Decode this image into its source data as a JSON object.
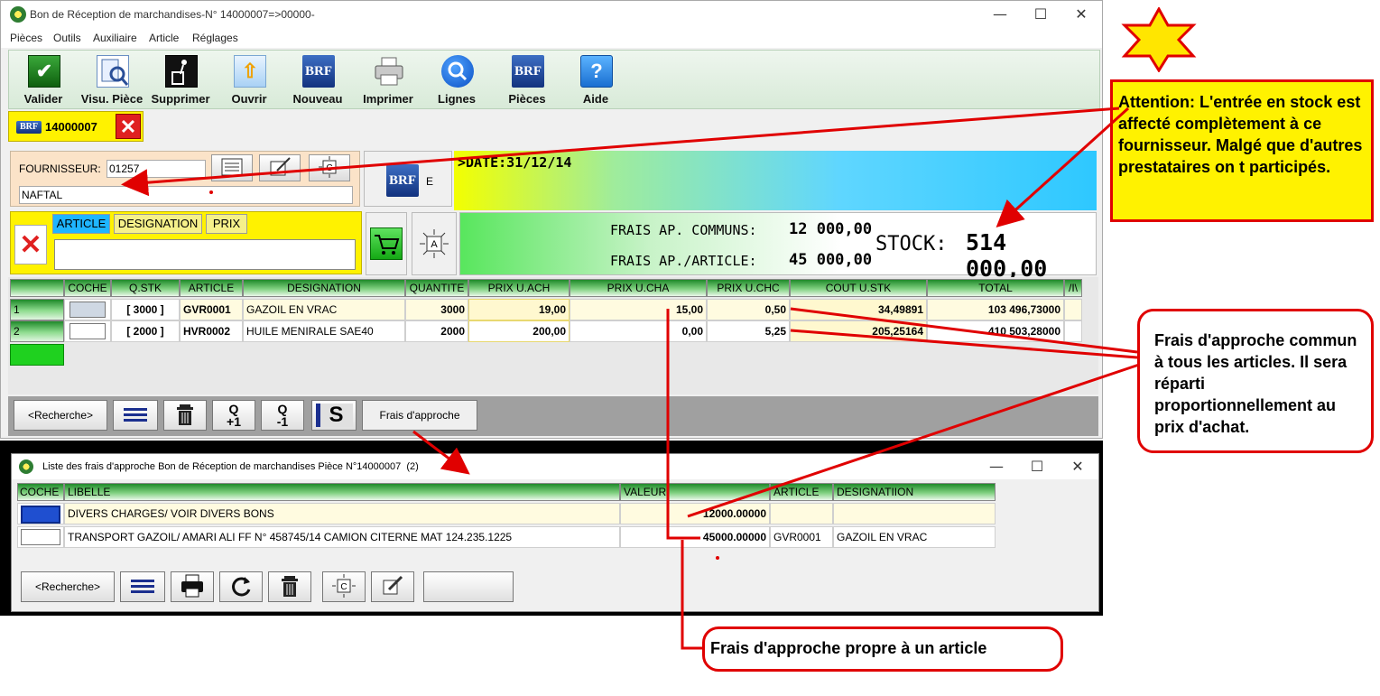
{
  "main_window": {
    "title": "Bon de Réception de marchandises-N° 14000007=>00000-",
    "controls": {
      "minimize": "—",
      "maximize": "☐",
      "close": "✕"
    },
    "menu": [
      "Pièces",
      "Outils",
      "Auxiliaire",
      "Article",
      "Réglages"
    ],
    "toolbar": [
      {
        "label": "Valider",
        "icon": "valider-icon"
      },
      {
        "label": "Visu. Pièce",
        "icon": "preview-icon"
      },
      {
        "label": "Supprimer",
        "icon": "trash-icon"
      },
      {
        "label": "Ouvrir",
        "icon": "open-icon"
      },
      {
        "label": "Nouveau",
        "icon": "brf-logo-icon"
      },
      {
        "label": "Imprimer",
        "icon": "printer-icon"
      },
      {
        "label": "Lignes",
        "icon": "search-icon"
      },
      {
        "label": "Pièces",
        "icon": "brf-logo-icon"
      },
      {
        "label": "Aide",
        "icon": "help-icon"
      }
    ],
    "piece_tab": {
      "logo": "BRF",
      "number": "14000007",
      "close": "✕"
    },
    "fournisseur": {
      "label": "FOURNISSEUR:",
      "code": "01257",
      "name": "NAFTAL"
    },
    "brf_panel": {
      "logo": "BRF",
      "letter": "E"
    },
    "date_text": ">DATE:31/12/14",
    "search": {
      "tabs": [
        "ARTICLE",
        "DESIGNATION",
        "PRIX"
      ],
      "value": "",
      "clear": "✕"
    },
    "frais": {
      "communs_label": "FRAIS AP. COMMUNS:",
      "communs_value": "12 000,00",
      "article_label": "FRAIS AP./ARTICLE:",
      "article_value": "45 000,00",
      "stock_label": "STOCK:",
      "stock_value": "514 000,00"
    },
    "grid": {
      "columns": [
        "",
        "COCHE",
        "Q.STK",
        "ARTICLE",
        "DESIGNATION",
        "QUANTITE",
        "PRIX U.ACH",
        "PRIX U.CHA",
        "PRIX U.CHC",
        "COUT U.STK",
        "TOTAL",
        "/I\\"
      ],
      "rows": [
        {
          "n": "1",
          "qstk": "[ 3000 ]",
          "article": "GVR0001",
          "designation": "GAZOIL EN VRAC",
          "quantite": "3000",
          "prix_ach": "19,00",
          "prix_cha": "15,00",
          "prix_chc": "0,50",
          "cout": "34,49891",
          "total": "103 496,73000"
        },
        {
          "n": "2",
          "qstk": "[ 2000 ]",
          "article": "HVR0002",
          "designation": "HUILE MENIRALE SAE40",
          "quantite": "2000",
          "prix_ach": "200,00",
          "prix_cha": "0,00",
          "prix_chc": "5,25",
          "cout": "205,25164",
          "total": "410 503,28000"
        }
      ]
    },
    "bottom_bar": {
      "search_btn": "<Recherche>",
      "q_plus": "Q\n+1",
      "q_minus": "Q\n-1",
      "s_label": "S",
      "frais_btn": "Frais d'approche"
    }
  },
  "sub_window": {
    "title": "Liste des frais d'approche Bon de Réception de marchandises Pièce N°14000007",
    "count": "(2)",
    "controls": {
      "minimize": "—",
      "maximize": "☐",
      "close": "✕"
    },
    "columns": [
      "COCHE",
      "LIBELLE",
      "VALEUR",
      "ARTICLE",
      "DESIGNATIION"
    ],
    "rows": [
      {
        "libelle": "DIVERS CHARGES/ VOIR DIVERS BONS",
        "valeur": "12000.00000",
        "article": "",
        "designation": ""
      },
      {
        "libelle": "TRANSPORT GAZOIL/  AMARI ALI  FF N° 458745/14  CAMION CITERNE MAT 124.235.1225",
        "valeur": "45000.00000",
        "article": "GVR0001",
        "designation": "GAZOIL EN VRAC"
      }
    ],
    "search_btn": "<Recherche>",
    "c_label": "C"
  },
  "annotations": {
    "stock_note": "Attention: L'entrée en stock est affecté complètement à ce fournisseur. Malgé que d'autres prestataires on t participés.",
    "common_note": "Frais d'approche commun à tous les articles. Il sera réparti proportionnellement au prix d'achat.",
    "article_note": "Frais d'approche propre à un article"
  },
  "colors": {
    "accent_green": "#1f8a2a",
    "annotation_red": "#e00000",
    "highlight_yellow": "#fff200"
  }
}
